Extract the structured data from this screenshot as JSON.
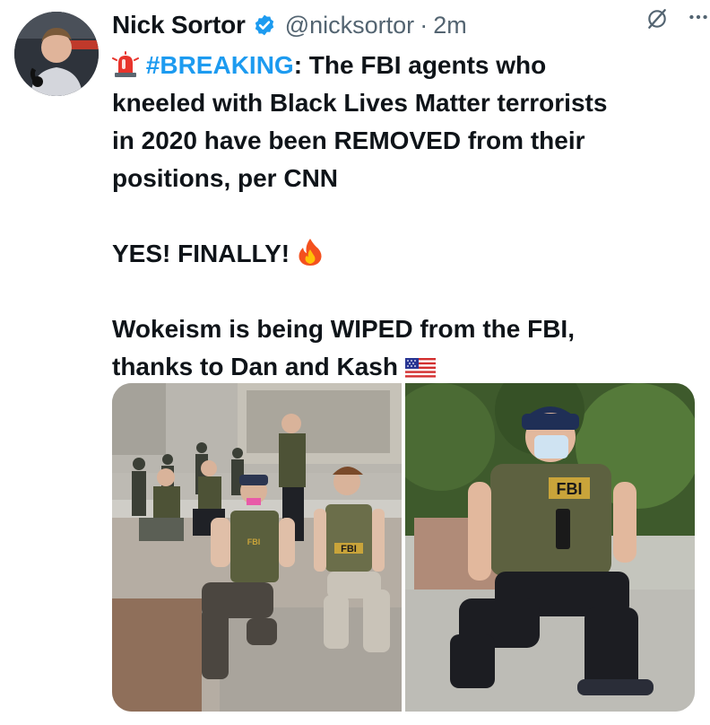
{
  "author": {
    "name": "Nick Sortor",
    "handle": "@nicksortor",
    "separator": "·",
    "time": "2m",
    "verified": true,
    "avatar_icon": "profile-photo"
  },
  "actions": {
    "grok_icon": "grok-icon",
    "more_icon": "more-dots-icon"
  },
  "tweet": {
    "emoji_siren": "siren-emoji",
    "hashtag": "#BREAKING",
    "line1_rest": ": The FBI agents who",
    "line2": "kneeled with Black Lives Matter terrorists",
    "line3": "in 2020 have been REMOVED from their",
    "line4": "positions, per CNN",
    "line5": "YES! FINALLY!",
    "emoji_fire": "fire-emoji",
    "line6": "Wokeism is being WIPED from the FBI,",
    "line7": "thanks to Dan and Kash",
    "emoji_flag": "us-flag-emoji"
  },
  "media": {
    "left_badge_1": "FBI",
    "left_badge_2": "FBI",
    "right_badge": "FBI"
  },
  "colors": {
    "text": "#0f1419",
    "secondary": "#536471",
    "link": "#1d9bf0",
    "verified": "#1d9bf0"
  }
}
